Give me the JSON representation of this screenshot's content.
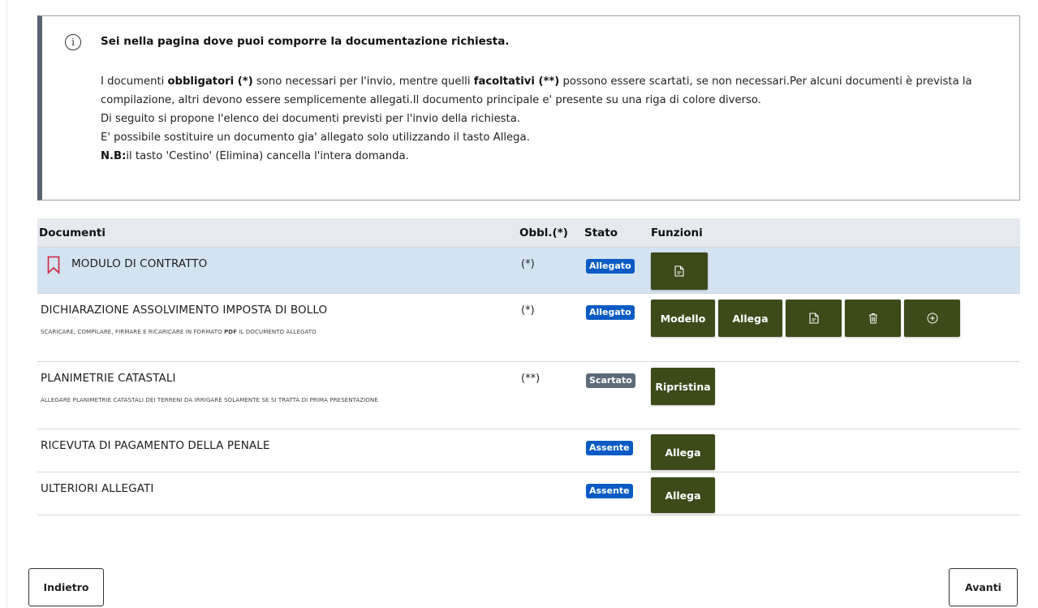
{
  "info": {
    "icon": "info-icon",
    "title": "Sei nella pagina dove puoi comporre la documentazione richiesta.",
    "p1": {
      "t1": "I documenti ",
      "b1": "obbligatori (*)",
      "t2": " sono necessari per l'invio, mentre quelli ",
      "b2": "facoltativi (**)",
      "t3": " possono essere scartati, se non necessari.Per alcuni documenti è prevista la compilazione, altri devono essere semplicemente allegati.Il documento principale e' presente su una riga di colore diverso."
    },
    "p2": "Di seguito si propone l'elenco dei documenti previsti per l'invio della richiesta.",
    "p3": "E' possibile sostituire un documento gia' allegato solo utilizzando il tasto Allega.",
    "p4": {
      "bold": "N.B:",
      "text": "il tasto 'Cestino' (Elimina) cancella l'intera domanda."
    }
  },
  "table": {
    "headers": {
      "documenti": "Documenti",
      "obbl": "Obbl.(*)",
      "stato": "Stato",
      "funzioni": "Funzioni"
    },
    "rows": [
      {
        "title": "MODULO DI CONTRATTO",
        "icon": "bookmark-icon",
        "obbl": "(*)",
        "stato": "Allegato",
        "buttons": [
          "document-icon"
        ]
      },
      {
        "title": "DICHIARAZIONE ASSOLVIMENTO IMPOSTA DI BOLLO",
        "note_pre": "SCARICARE, COMPILARE, FIRMARE E RICARICARE IN FORMATO ",
        "note_bold": "PDF",
        "note_post": " IL DOCUMENTO ALLEGATO",
        "obbl": "(*)",
        "stato": "Allegato",
        "modello_label": "Modello",
        "allega_label": "Allega",
        "buttons": [
          "document-icon",
          "trash-icon",
          "plus-circle-icon"
        ]
      },
      {
        "title": "PLANIMETRIE CATASTALI",
        "note": "ALLEGARE PLANIMETRIE CATASTALI DEI TERRENI DA IRRIGARE SOLAMENTE SE SI TRATTA DI PRIMA PRESENTAZIONE",
        "obbl": "(**)",
        "stato": "Scartato",
        "ripristina_label": "Ripristina"
      },
      {
        "title": "RICEVUTA DI PAGAMENTO DELLA PENALE",
        "obbl": "",
        "stato": "Assente",
        "allega_label": "Allega"
      },
      {
        "title": "ULTERIORI ALLEGATI",
        "obbl": "",
        "stato": "Assente",
        "allega_label": "Allega"
      }
    ]
  },
  "nav": {
    "back": "Indietro",
    "next": "Avanti"
  },
  "colors": {
    "button_bg": "#3d4a1a",
    "badge_blue": "#0a5bc4",
    "badge_gray": "#5d6b7a",
    "main_row_bg": "#d3e3f2",
    "bookmark": "#d0213c"
  }
}
